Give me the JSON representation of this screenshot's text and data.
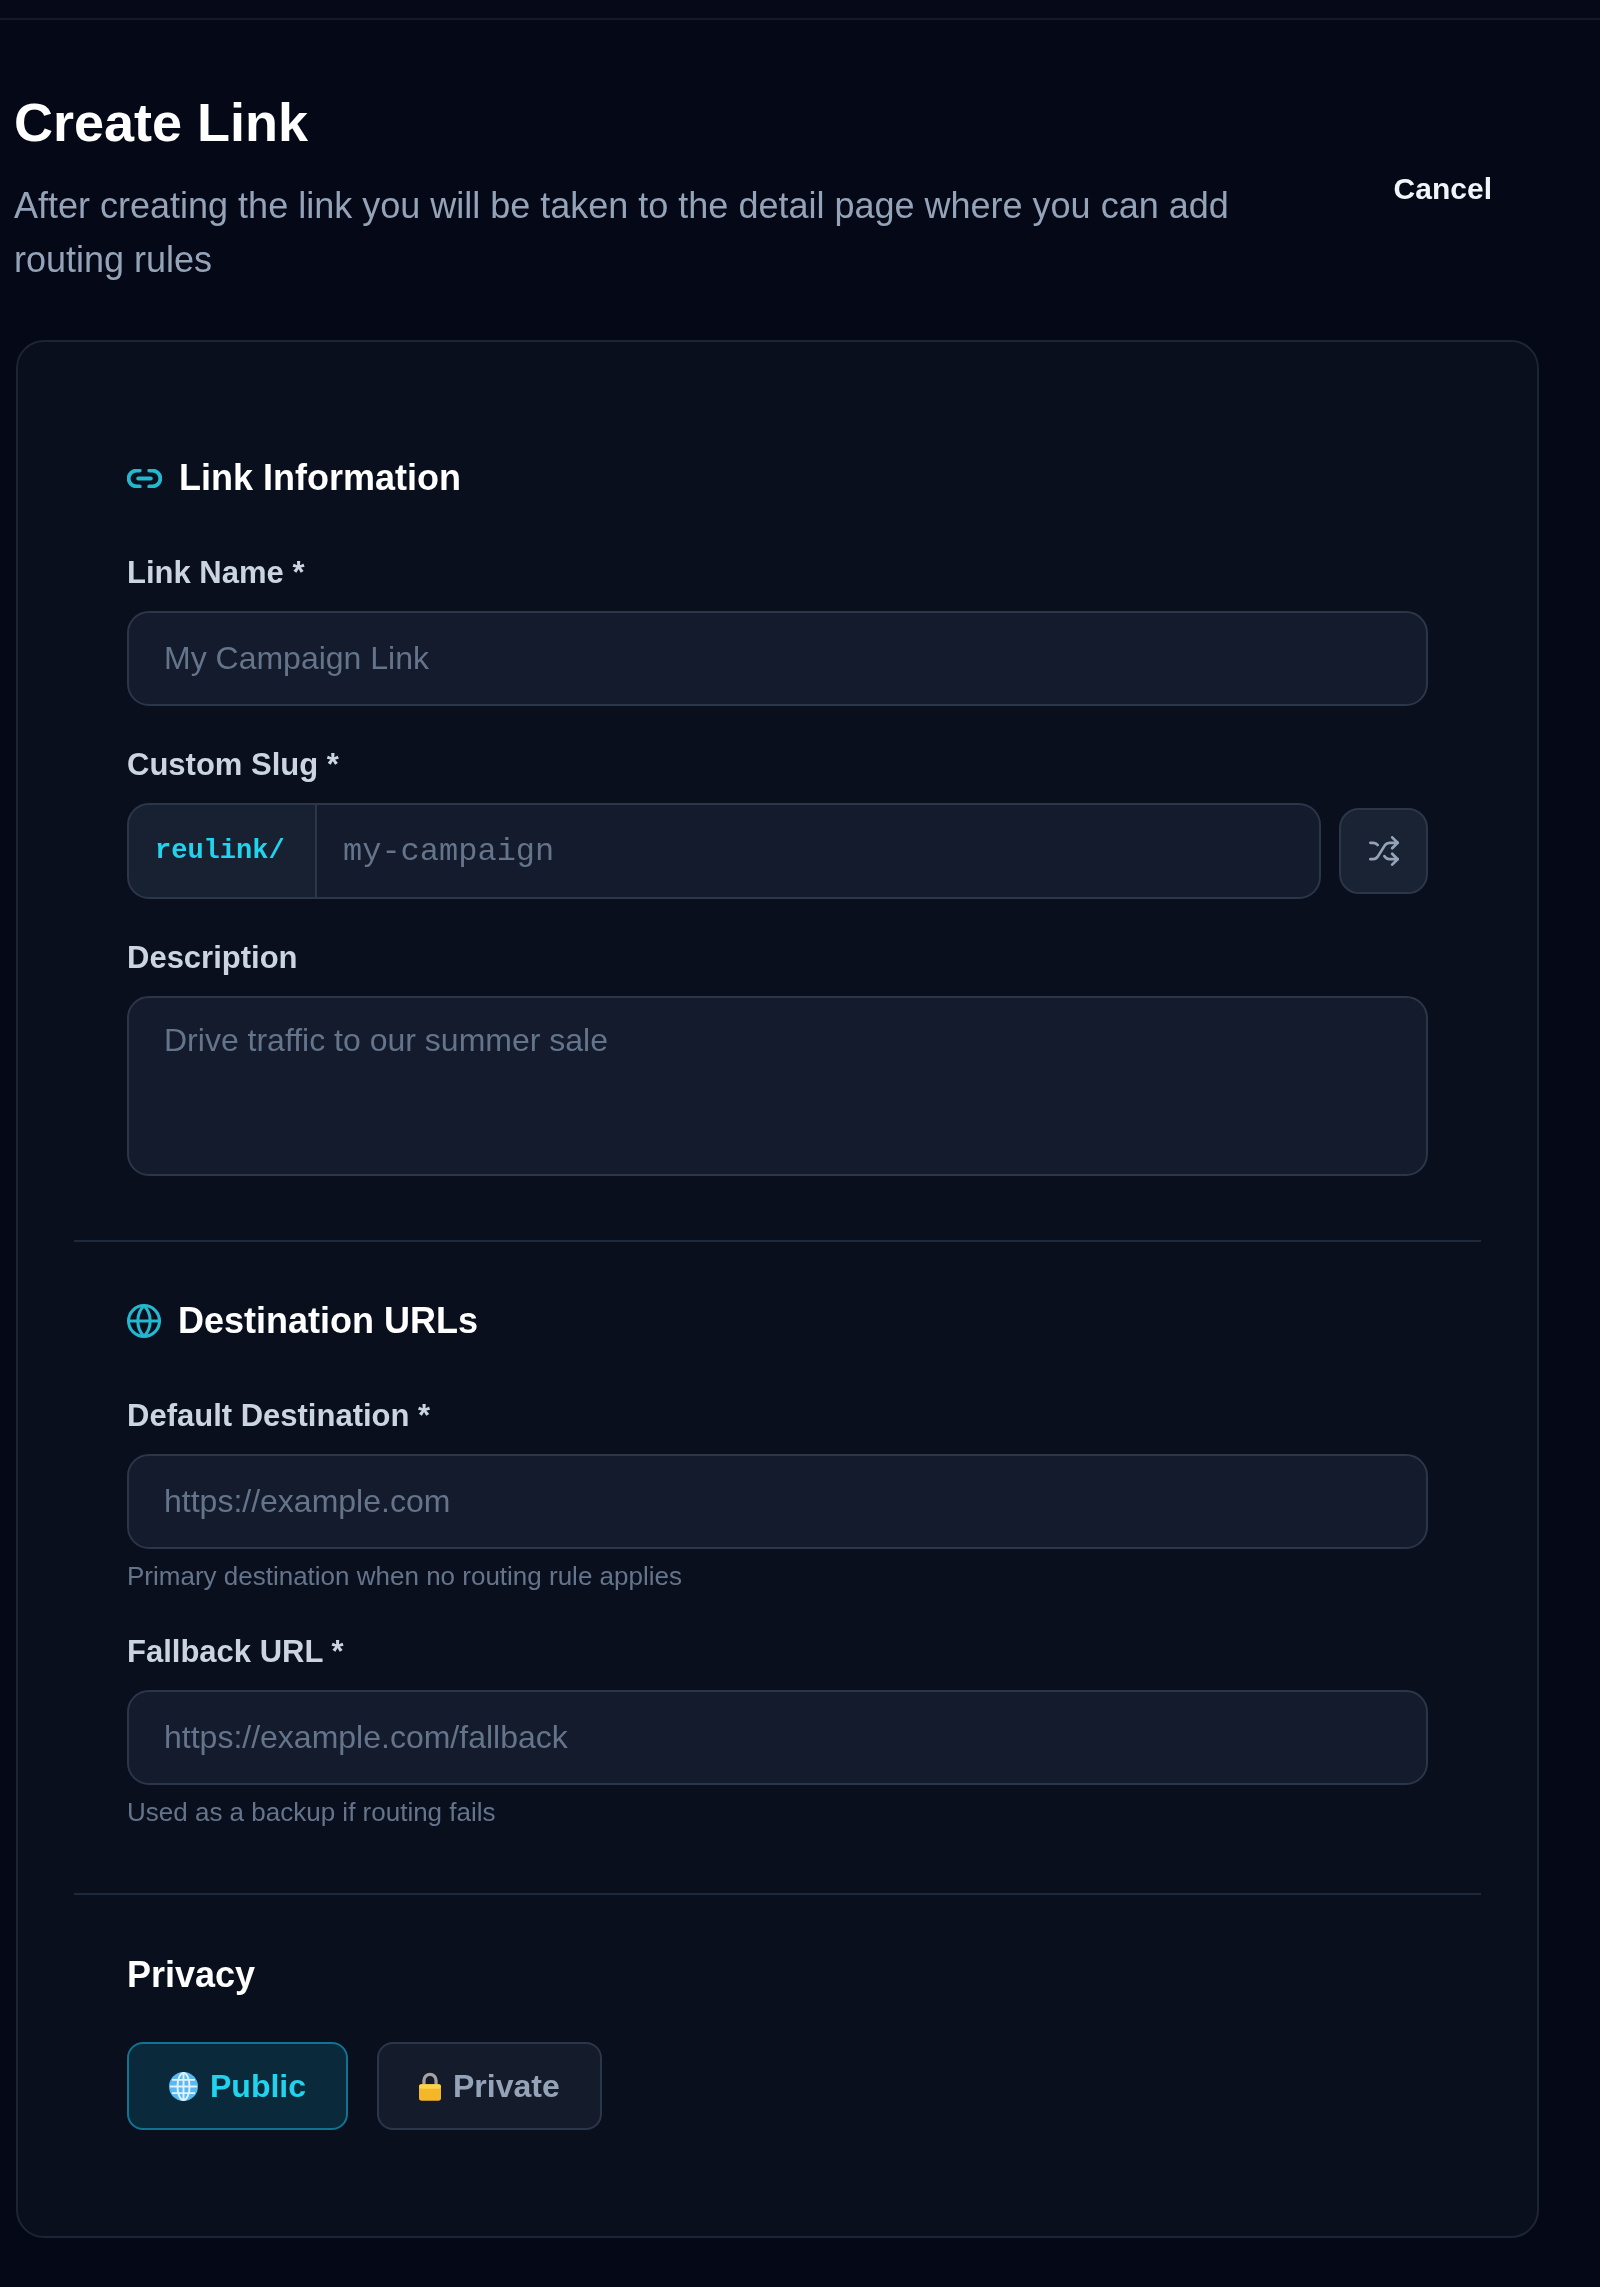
{
  "header": {
    "title": "Create Link",
    "subtitle": "After creating the link you will be taken to the detail page where you can add routing rules",
    "cancel": "Cancel"
  },
  "sections": [
    {
      "kind": "fields",
      "title": "Link Information",
      "fields": [
        {
          "kind": "input",
          "label": "Link Name *",
          "placeholder": "My Campaign Link"
        },
        {
          "kind": "slug",
          "label": "Custom Slug *",
          "prefix": "reulink/",
          "placeholder": "my-campaign"
        },
        {
          "kind": "textarea",
          "label": "Description",
          "placeholder": "Drive traffic to our summer sale"
        }
      ]
    },
    {
      "kind": "fields",
      "title": "Destination URLs",
      "fields": [
        {
          "kind": "input",
          "label": "Default Destination *",
          "placeholder": "https://example.com",
          "help": "Primary destination when no routing rule applies"
        },
        {
          "kind": "input",
          "label": "Fallback URL *",
          "placeholder": "https://example.com/fallback",
          "help": "Used as a backup if routing fails"
        }
      ]
    },
    {
      "kind": "choice",
      "title": "Privacy",
      "options": [
        {
          "label": "Public",
          "selected": true
        },
        {
          "label": "Private",
          "selected": false
        }
      ]
    }
  ]
}
